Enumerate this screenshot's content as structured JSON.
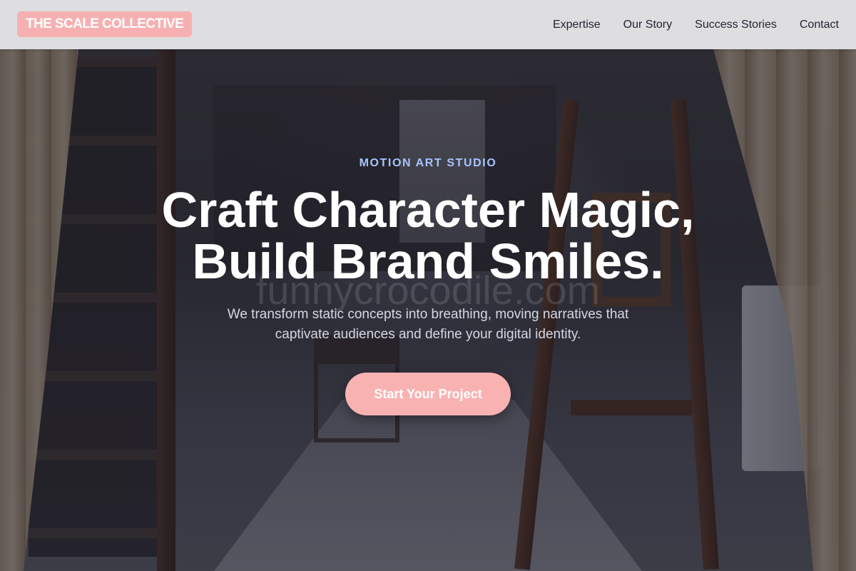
{
  "header": {
    "brand": "THE SCALE COLLECTIVE",
    "nav": [
      {
        "label": "Expertise"
      },
      {
        "label": "Our Story"
      },
      {
        "label": "Success Stories"
      },
      {
        "label": "Contact"
      }
    ]
  },
  "hero": {
    "eyebrow": "MOTION ART STUDIO",
    "headline_line1": "Craft Character Magic,",
    "headline_line2": "Build Brand Smiles.",
    "subtext": "We transform static concepts into breathing, moving narratives that captivate audiences and define your digital identity.",
    "cta_label": "Start Your Project",
    "watermark": "funnycrocodile.com"
  },
  "colors": {
    "brand_badge": "#f7b0b2",
    "cta": "#f9b2b2",
    "eyebrow": "#a8c4ff",
    "nav_text": "#1f2230",
    "header_bg": "#ececee"
  }
}
